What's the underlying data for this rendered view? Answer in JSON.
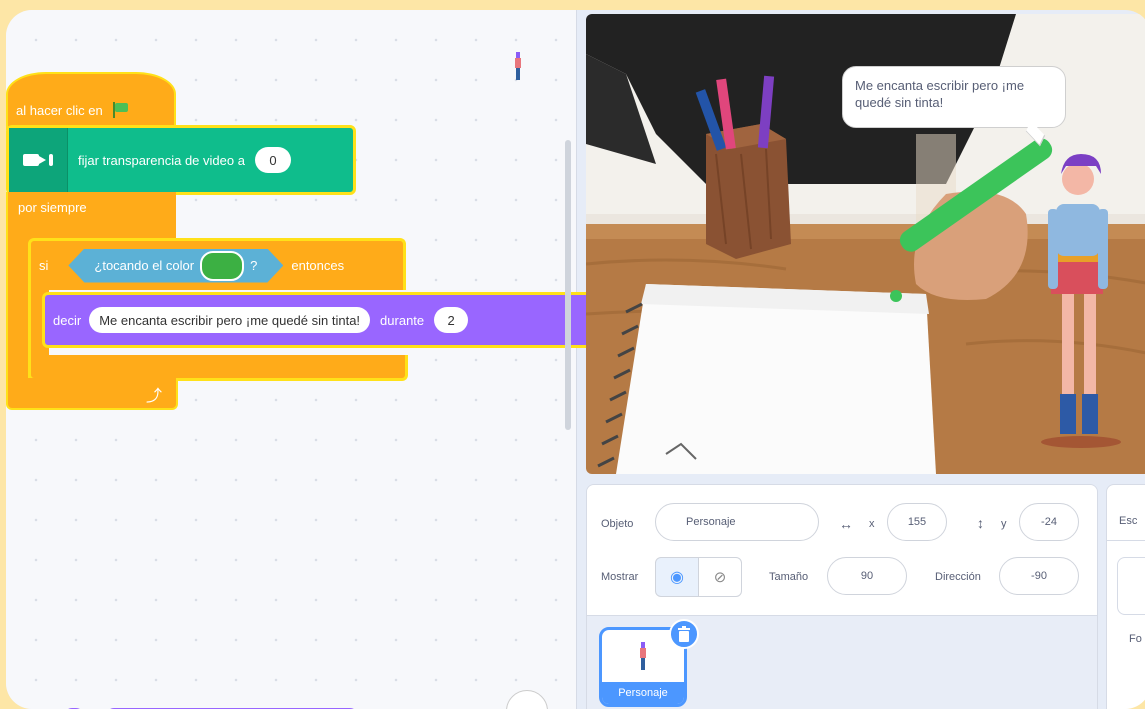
{
  "blocks": {
    "hat_label": "al hacer clic en",
    "video_label": "fijar transparencia de video a",
    "video_value": "0",
    "forever_label": "por siempre",
    "if_label": "si",
    "touching_label": "¿tocando el color",
    "touching_q": "?",
    "then_label": "entonces",
    "say_label": "decir",
    "say_text": "Me encanta escribir pero ¡me quedé sin tinta!",
    "for_label": "durante",
    "for_value": "2"
  },
  "stage": {
    "bubble_text": "Me encanta escribir pero ¡me quedé sin tinta!"
  },
  "sprite_info": {
    "object_label": "Objeto",
    "object_name": "Personaje",
    "x_label": "x",
    "x_value": "155",
    "y_label": "y",
    "y_value": "-24",
    "show_label": "Mostrar",
    "size_label": "Tamaño",
    "size_value": "90",
    "direction_label": "Dirección",
    "direction_value": "-90"
  },
  "sprite_list": {
    "items": [
      {
        "name": "Personaje"
      }
    ]
  },
  "stage_panel": {
    "title": "Esc",
    "label": "Fo"
  },
  "colors": {
    "events": "#ffab19",
    "video": "#0fbd8c",
    "sensing": "#5cb1d6",
    "looks": "#9966ff",
    "touch_color": "#3cb043",
    "highlight": "#ffe119",
    "selected": "#4c97ff"
  }
}
